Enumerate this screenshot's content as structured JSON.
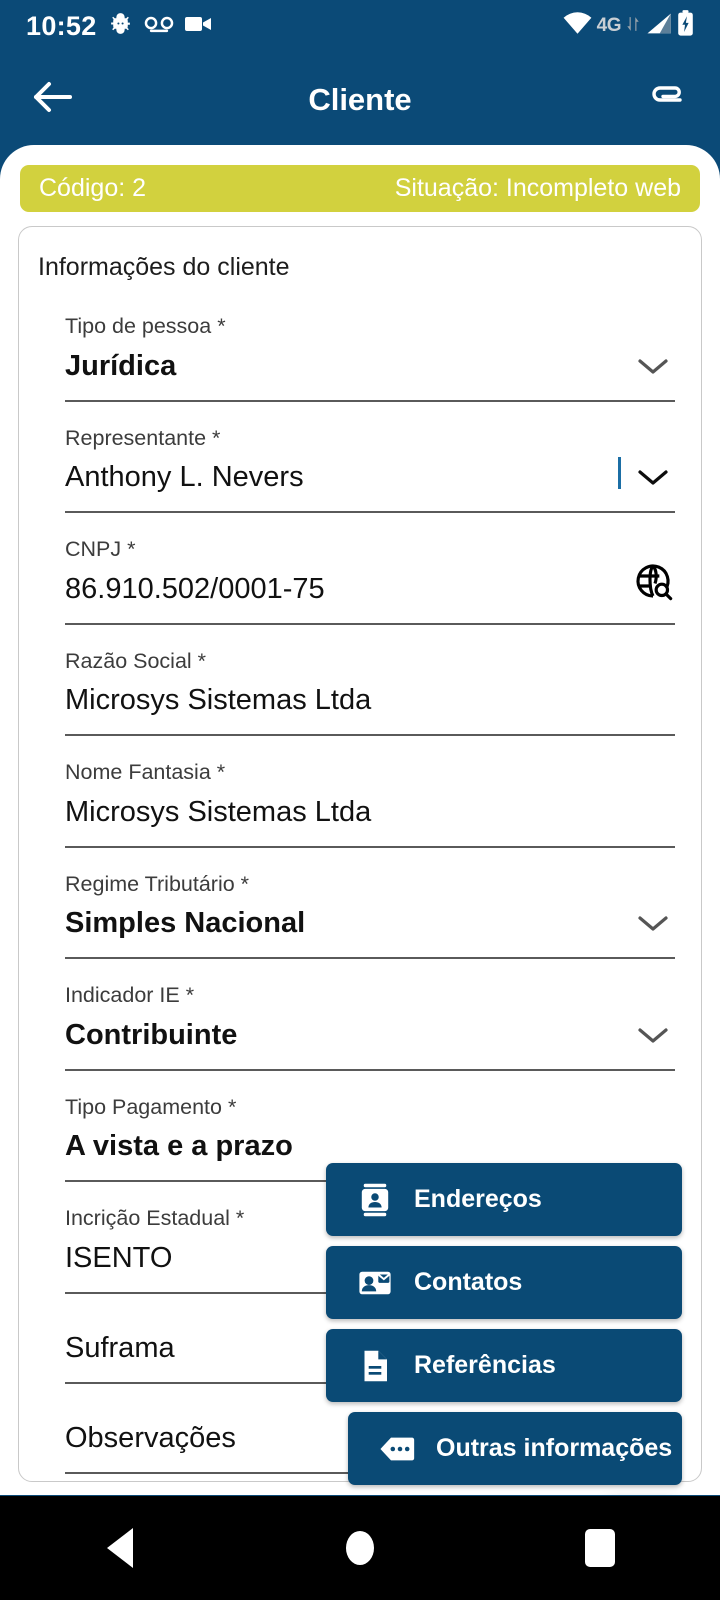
{
  "statusbar": {
    "time": "10:52",
    "left_icons": [
      "android-settings-icon",
      "voicemail-icon",
      "video-camera-icon"
    ],
    "network_label": "4G",
    "right_icons": [
      "wifi-icon",
      "mobile-data-icon",
      "signal-bars-icon",
      "battery-charging-icon"
    ]
  },
  "appbar": {
    "back_icon": "arrow-left-icon",
    "title": "Cliente",
    "action_icon": "attachment-icon"
  },
  "status_pill": {
    "code_label": "Código: 2",
    "situation_label": "Situação: Incompleto web"
  },
  "card": {
    "title": "Informações do cliente",
    "fields": [
      {
        "label": "Tipo de pessoa *",
        "value": "Jurídica",
        "bold": true,
        "trailing": "chevron-down-icon"
      },
      {
        "label": "Representante *",
        "value": "Anthony L. Nevers",
        "bold": false,
        "trailing": "chevron-down-icon",
        "caret": true
      },
      {
        "label": "CNPJ *",
        "value": "86.910.502/0001-75",
        "bold": false,
        "trailing": "globe-search-icon"
      },
      {
        "label": "Razão Social *",
        "value": "Microsys Sistemas Ltda",
        "bold": false,
        "trailing": "none"
      },
      {
        "label": "Nome Fantasia *",
        "value": "Microsys Sistemas Ltda",
        "bold": false,
        "trailing": "none"
      },
      {
        "label": "Regime Tributário *",
        "value": "Simples Nacional",
        "bold": true,
        "trailing": "chevron-down-icon"
      },
      {
        "label": "Indicador IE *",
        "value": "Contribuinte",
        "bold": true,
        "trailing": "chevron-down-icon"
      },
      {
        "label": "Tipo Pagamento *",
        "value": "A vista e a prazo",
        "bold": true,
        "trailing": "none"
      },
      {
        "label": "Incrição Estadual *",
        "value": "ISENTO",
        "bold": false,
        "trailing": "none"
      },
      {
        "label": "",
        "value": "Suframa",
        "bold": false,
        "trailing": "none",
        "empty": true
      },
      {
        "label": "",
        "value": "Observações",
        "bold": false,
        "trailing": "none",
        "empty": true
      }
    ]
  },
  "menu": {
    "items": [
      {
        "label": "Endereços",
        "icon": "contact-card-icon"
      },
      {
        "label": "Contatos",
        "icon": "contact-mail-icon"
      },
      {
        "label": "Referências",
        "icon": "document-icon"
      },
      {
        "label": "Outras informações",
        "icon": "more-info-icon"
      }
    ]
  },
  "fab": {
    "icon": "person-icon"
  },
  "navbar": {
    "back_icon": "nav-back-icon",
    "home_icon": "nav-home-icon",
    "recent_icon": "nav-recent-icon"
  },
  "colors": {
    "primary": "#0b4a77",
    "menu_blue": "#0a4a75",
    "badge_yellow": "#d2d13e",
    "sheet": "#ffffff",
    "navbar": "#000000",
    "caret": "#1b6ea5"
  }
}
